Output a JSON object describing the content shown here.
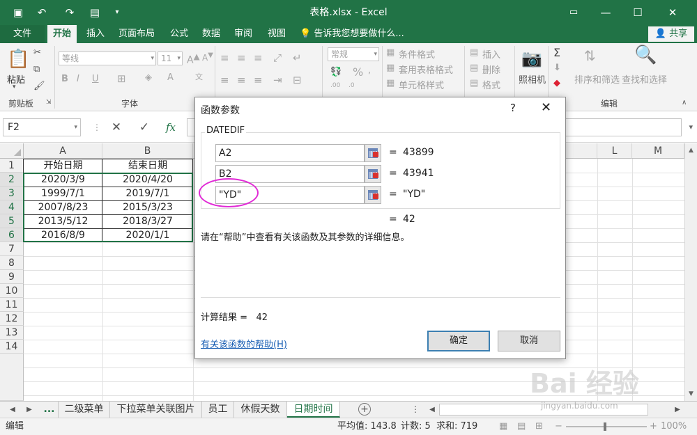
{
  "window": {
    "title": "表格.xlsx - Excel",
    "accent": "#217346"
  },
  "tabs": {
    "file": "文件",
    "items": [
      "开始",
      "插入",
      "页面布局",
      "公式",
      "数据",
      "审阅",
      "视图"
    ],
    "tellme": "告诉我您想要做什么...",
    "share": "共享"
  },
  "ribbon": {
    "paste": "粘贴",
    "clipboard": "剪贴板",
    "font_name": "等线",
    "font_size": "11",
    "font_group": "字体",
    "number_format": "常规",
    "conditional_format": "条件格式",
    "table_format": "套用表格格式",
    "cell_style": "单元格样式",
    "insert": "插入",
    "delete": "删除",
    "format": "格式",
    "camera": "照相机",
    "sort_filter": "排序和筛选",
    "find_select": "查找和选择",
    "edit_group": "编辑"
  },
  "formula_bar": {
    "name_box": "F2",
    "fx": "fx"
  },
  "grid": {
    "columns": [
      "A",
      "B",
      "L",
      "M"
    ],
    "rows": [
      "1",
      "2",
      "3",
      "4",
      "5",
      "6",
      "7",
      "8",
      "9",
      "10",
      "11",
      "12",
      "13",
      "14"
    ],
    "headers": [
      "开始日期",
      "结束日期"
    ],
    "data": [
      [
        "2020/3/9",
        "2020/4/20"
      ],
      [
        "1999/7/1",
        "2019/7/1"
      ],
      [
        "2007/8/23",
        "2015/3/23"
      ],
      [
        "2013/5/12",
        "2018/3/27"
      ],
      [
        "2016/8/9",
        "2020/1/1"
      ]
    ]
  },
  "sheets": {
    "more": "...",
    "items": [
      "二级菜单",
      "下拉菜单关联图片",
      "员工",
      "休假天数",
      "日期时间"
    ],
    "active_index": 4
  },
  "status": {
    "mode": "编辑",
    "average": "平均值: 143.8",
    "count": "计数: 5",
    "sum": "求和: 719",
    "zoom": "100%"
  },
  "dialog": {
    "title": "函数参数",
    "help_q": "?",
    "function_name": "DATEDIF",
    "args": [
      {
        "input": "A2",
        "value": "43899"
      },
      {
        "input": "B2",
        "value": "43941"
      },
      {
        "input": "\"YD\"",
        "value": "\"YD\""
      }
    ],
    "eq": "=",
    "formula_value": "42",
    "description": "请在“帮助”中查看有关该函数及其参数的详细信息。",
    "result_label": "计算结果 =",
    "result_value": "42",
    "help_link": "有关该函数的帮助(H)",
    "ok": "确定",
    "cancel": "取消"
  },
  "watermark": {
    "brand": "Bai 经验",
    "url": "jingyan.baidu.com"
  }
}
